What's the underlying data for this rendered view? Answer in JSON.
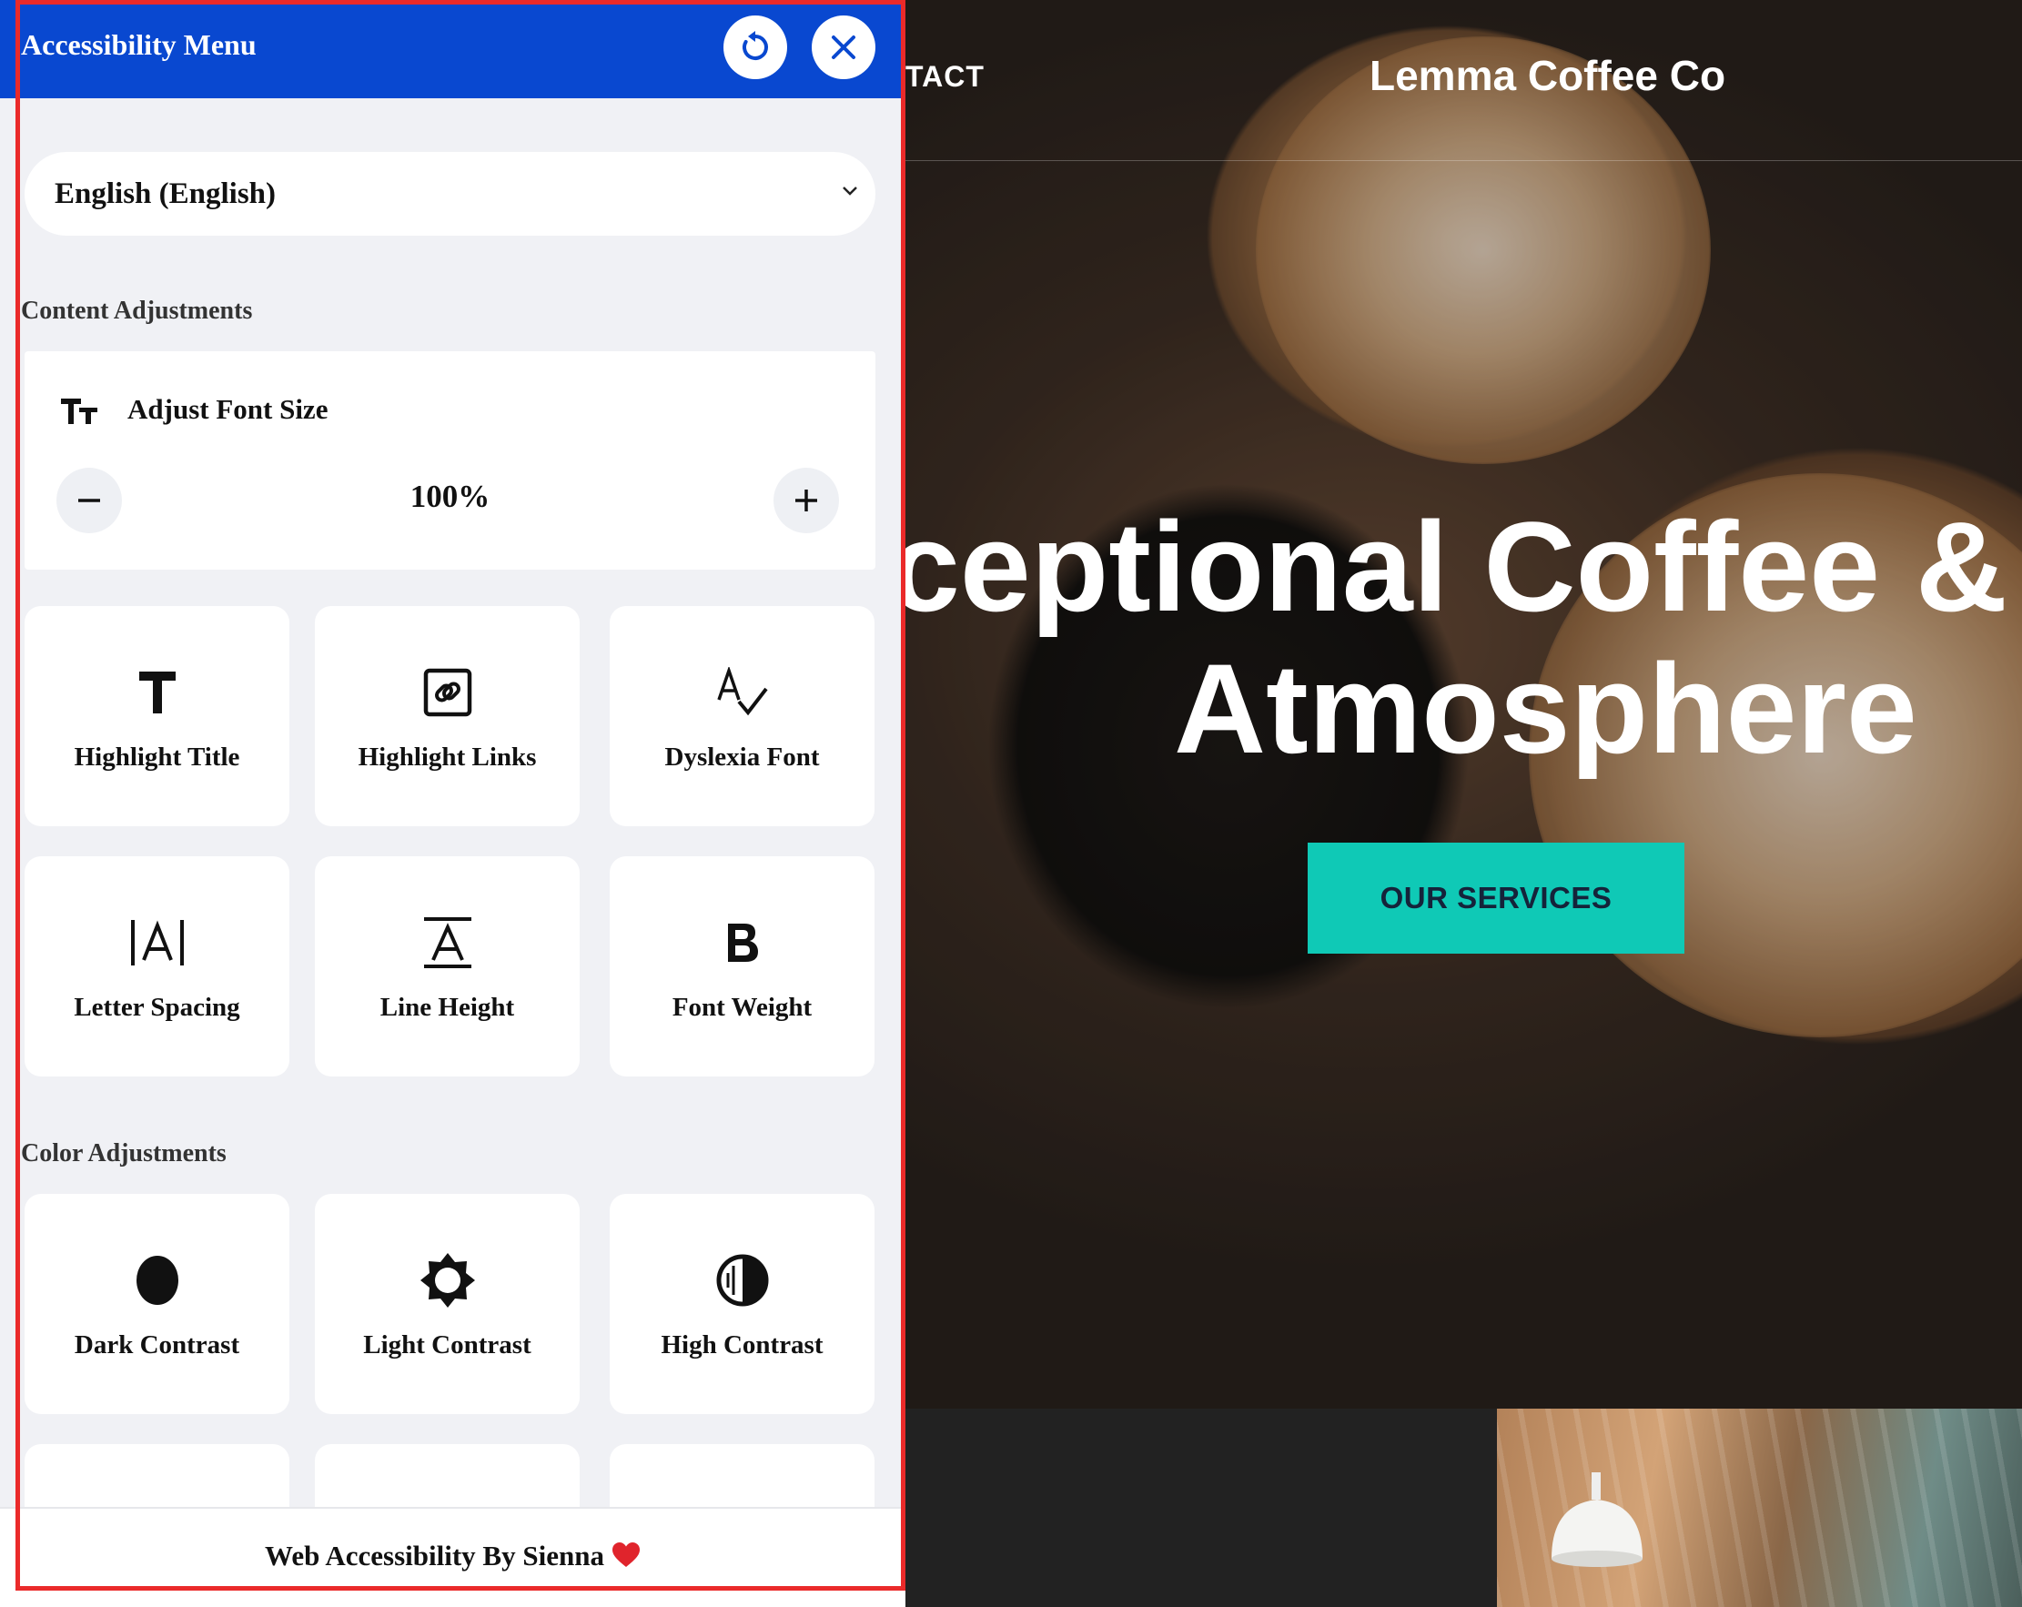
{
  "panel": {
    "title": "Accessibility Menu",
    "language": "English (English)",
    "sections": {
      "content": "Content Adjustments",
      "color": "Color Adjustments"
    },
    "font_size": {
      "label": "Adjust Font Size",
      "value": "100%"
    },
    "content_tiles": [
      {
        "label": "Highlight Title",
        "icon": "title-t-icon"
      },
      {
        "label": "Highlight Links",
        "icon": "link-icon"
      },
      {
        "label": "Dyslexia Font",
        "icon": "dyslexia-font-icon"
      },
      {
        "label": "Letter Spacing",
        "icon": "letter-spacing-icon"
      },
      {
        "label": "Line Height",
        "icon": "line-height-icon"
      },
      {
        "label": "Font Weight",
        "icon": "bold-b-icon"
      }
    ],
    "color_tiles": [
      {
        "label": "Dark Contrast",
        "icon": "dark-contrast-icon"
      },
      {
        "label": "Light Contrast",
        "icon": "light-contrast-icon"
      },
      {
        "label": "High Contrast",
        "icon": "high-contrast-icon"
      }
    ],
    "footer": "Web Accessibility By Sienna",
    "colors": {
      "header_bg": "#0948d0",
      "outline": "#ea2a2a",
      "panel_bg": "#f0f1f5"
    }
  },
  "site": {
    "nav_partial": "TACT",
    "brand": "Lemma Coffee Co",
    "hero_line1": "ceptional Coffee & Inv",
    "hero_line2": "Atmosphere",
    "cta": "OUR SERVICES",
    "colors": {
      "cta_bg": "#0fc9b6"
    }
  }
}
